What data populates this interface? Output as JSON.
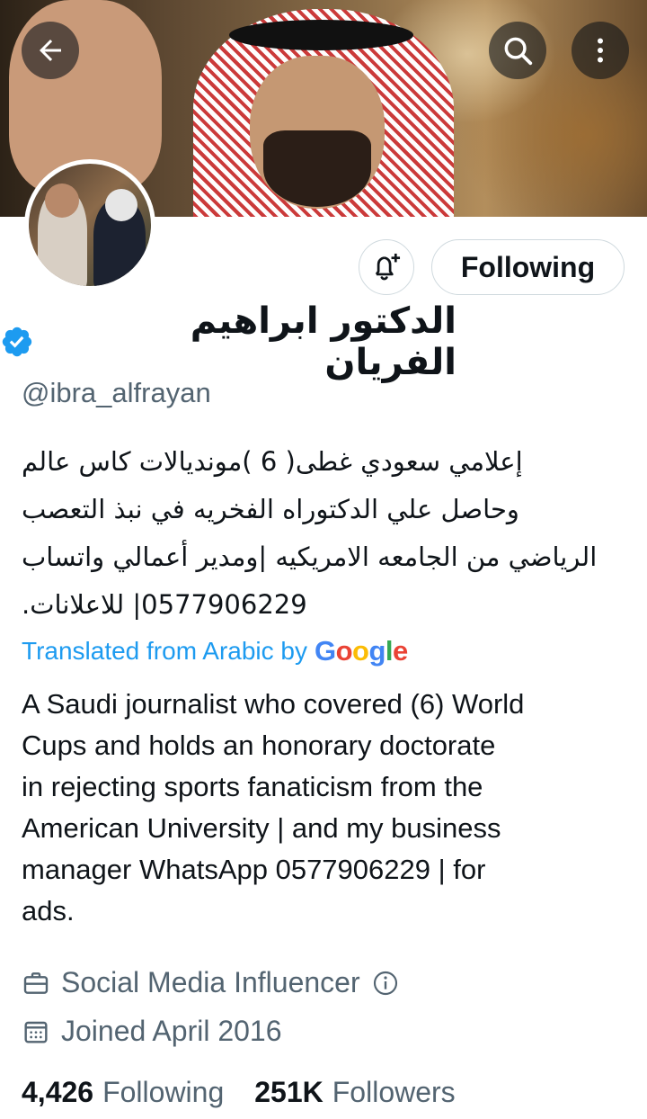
{
  "header": {
    "back_icon": "arrow-left-icon",
    "search_icon": "search-icon",
    "more_icon": "more-vertical-icon"
  },
  "profile": {
    "display_name": "الدكتور ابراهيم الفريان",
    "verified_icon": "verified-badge-icon",
    "handle": "@ibra_alfrayan",
    "bio_ar_lines": [
      "إعلامي سعودي غطى( 6 )مونديالات كاس عالم",
      "وحاصل علي الدكتوراه الفخريه في نبذ التعصب",
      "الرياضي من الجامعه الامريكيه |ومدير أعمالي واتساب",
      "0577906229| للاعلانات."
    ],
    "translated_label": "Translated from Arabic by",
    "translator": [
      "G",
      "o",
      "o",
      "g",
      "l",
      "e"
    ],
    "bio_en_lines": [
      "A Saudi journalist who covered (6) World",
      "Cups and holds an honorary doctorate",
      "in rejecting sports fanaticism from the",
      "American University | and my business",
      "manager WhatsApp 0577906229 | for",
      "ads."
    ],
    "category": "Social Media Influencer",
    "joined": "Joined April 2016",
    "following_count": "4,426",
    "following_label": "Following",
    "followers_count": "251K",
    "followers_label": "Followers"
  },
  "actions": {
    "notify_icon": "bell-plus-icon",
    "follow_button_label": "Following"
  },
  "colors": {
    "link_blue": "#1d9bf0",
    "secondary_text": "#536471",
    "verified_blue": "#1d9bf0",
    "google_blue": "#4285F4",
    "google_red": "#EA4335",
    "google_yellow": "#FBBC05",
    "google_green": "#34A853"
  }
}
